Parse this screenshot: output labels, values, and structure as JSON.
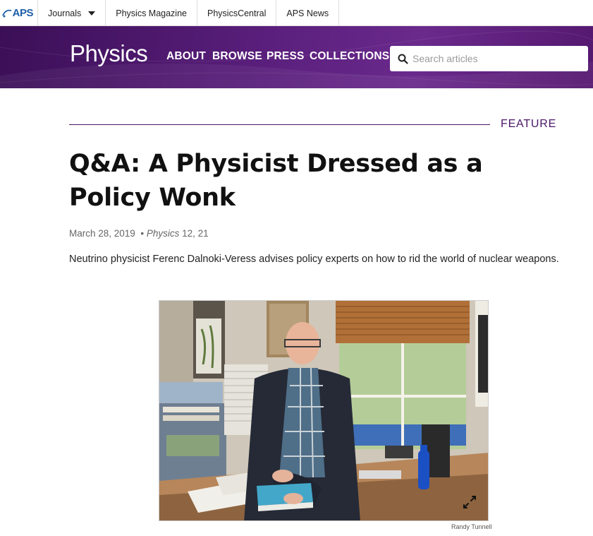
{
  "topbar": {
    "logo_text": "APS",
    "items": [
      {
        "label": "Journals",
        "has_dropdown": true
      },
      {
        "label": "Physics Magazine"
      },
      {
        "label": "PhysicsCentral"
      },
      {
        "label": "APS News"
      }
    ]
  },
  "header": {
    "brand": "Physics",
    "nav": [
      "ABOUT",
      "BROWSE",
      "PRESS",
      "COLLECTIONS"
    ],
    "search_placeholder": "Search articles",
    "colors": {
      "primary": "#4a1668",
      "gradient_end": "#6a2a8c"
    }
  },
  "article": {
    "category": "FEATURE",
    "title": "Q&A: A Physicist Dressed as a Policy Wonk",
    "date": "March 28, 2019",
    "journal": "Physics",
    "volume_ref": "12, 21",
    "summary": "Neutrino physicist Ferenc Dalnoki-Veress advises policy experts on how to rid the world of nuclear weapons.",
    "photo_credit": "Randy Tunnell"
  },
  "icons": {
    "search": "search-icon",
    "expand": "expand-icon",
    "dropdown": "caret-down-icon"
  }
}
